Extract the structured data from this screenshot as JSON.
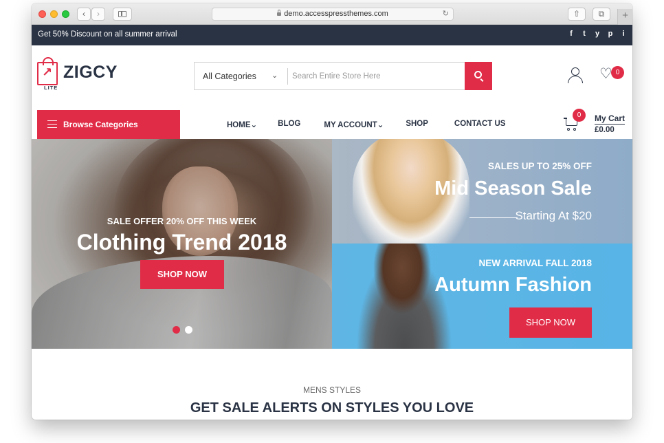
{
  "browser": {
    "url": "demo.accesspressthemes.com",
    "back_icon": "‹",
    "forward_icon": "›",
    "reload_icon": "↻",
    "share_icon": "⇧",
    "tabs_icon": "⧉",
    "new_tab_icon": "+"
  },
  "topbar": {
    "promo": "Get 50% Discount on all summer arrival",
    "social": [
      "f",
      "t",
      "y",
      "p",
      "i"
    ]
  },
  "header": {
    "brand": "ZIGCY",
    "brand_tag": "LITE",
    "search": {
      "category": "All Categories",
      "placeholder": "Search Entire Store Here"
    },
    "wishlist_count": "0",
    "cart_count": "0",
    "cart_label": "My Cart",
    "cart_total": "£0.00"
  },
  "nav": {
    "browse": "Browse Categories",
    "items": [
      "HOME",
      "BLOG",
      "MY ACCOUNT",
      "SHOP",
      "CONTACT US"
    ],
    "caret": "⌄"
  },
  "hero": {
    "main": {
      "sub": "SALE OFFER 20% OFF THIS WEEK",
      "title": "Clothing Trend 2018",
      "button": "SHOP NOW"
    },
    "top_right": {
      "sub": "SALES UP TO 25% OFF",
      "title": "Mid Season Sale",
      "note": "Starting At $20"
    },
    "bottom_right": {
      "sub": "NEW ARRIVAL FALL 2018",
      "title": "Autumn Fashion",
      "button": "SHOP NOW"
    }
  },
  "section": {
    "sub": "MENS STYLES",
    "title": "GET SALE ALERTS ON STYLES YOU LOVE"
  },
  "colors": {
    "accent": "#e12c47",
    "dark": "#2a3344"
  }
}
